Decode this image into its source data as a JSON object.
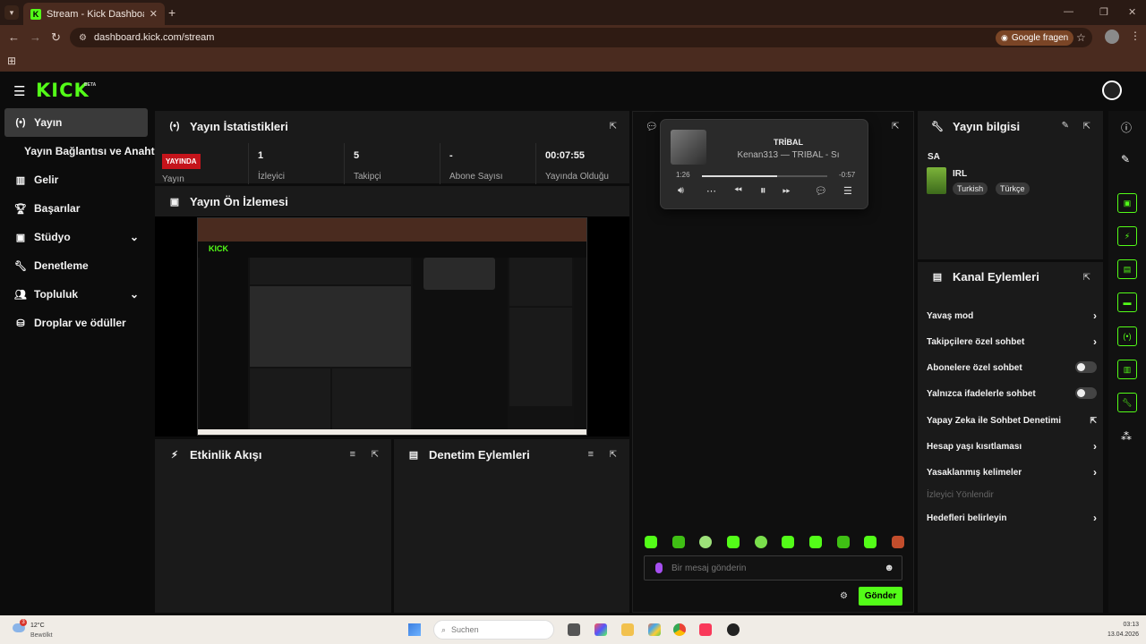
{
  "browser": {
    "tab_title": "Stream - Kick Dashboard",
    "tab_favicon": "K",
    "url": "dashboard.kick.com/stream",
    "translate_label": "Google fragen"
  },
  "header": {
    "logo": "KICK",
    "beta": "BETA"
  },
  "sidebar": {
    "items": [
      {
        "label": "Yayın",
        "icon": "broadcast-icon"
      },
      {
        "label": "Yayın Bağlantısı ve Anahtarı",
        "icon": ""
      },
      {
        "label": "Gelir",
        "icon": "chart-icon"
      },
      {
        "label": "Başarılar",
        "icon": "trophy-icon"
      },
      {
        "label": "Stüdyo",
        "icon": "studio-icon"
      },
      {
        "label": "Denetleme",
        "icon": "wrench-icon"
      },
      {
        "label": "Topluluk",
        "icon": "people-icon"
      },
      {
        "label": "Droplar ve ödüller",
        "icon": "gift-icon"
      }
    ]
  },
  "stats": {
    "title": "Yayın İstatistikleri",
    "live_badge": "YAYINDA",
    "live_label": "Yayın",
    "viewers_value": "1",
    "viewers_label": "İzleyici",
    "followers_value": "5",
    "followers_label": "Takipçi",
    "subs_value": "-",
    "subs_label": "Abone Sayısı",
    "uptime_value": "00:07:55",
    "uptime_label": "Yayında Olduğu"
  },
  "preview": {
    "title": "Yayın Ön İzlemesi"
  },
  "activity": {
    "title": "Etkinlik Akışı"
  },
  "modactions": {
    "title": "Denetim Eylemleri"
  },
  "music": {
    "song": "TRİBAL",
    "artist": "Kenan313 — TRİBAL - Sı",
    "elapsed": "1:26",
    "remaining": "-0:57",
    "progress": 0.6
  },
  "chat": {
    "placeholder": "Bir mesaj gönderin",
    "send_label": "Gönder"
  },
  "stream_info": {
    "title": "Yayın bilgisi",
    "stream_title": "SA",
    "category": "IRL",
    "tags": [
      "Turkish",
      "Türkçe"
    ]
  },
  "channel_actions": {
    "title": "Kanal Eylemleri",
    "slow_mode": "Yavaş mod",
    "followers_only": "Takipçilere özel sohbet",
    "subs_only": "Abonelere özel sohbet",
    "emotes_only": "Yalnızca ifadelerle sohbet",
    "ai_moderation": "Yapay Zeka ile Sohbet Denetimi",
    "account_age": "Hesap yaşı kısıtlaması",
    "banned_words": "Yasaklanmış kelimeler",
    "redirect_viewers": "İzleyici Yönlendir",
    "set_goals": "Hedefleri belirleyin"
  },
  "taskbar": {
    "weather_badge": "3",
    "weather_temp": "12°C",
    "weather_desc": "Bewölkt",
    "search_placeholder": "Suchen",
    "time": "03:13",
    "date": "13.04.2026"
  },
  "colors": {
    "accent": "#53fc18",
    "live": "#c5141b",
    "panel": "#1a1a1a",
    "bg": "#0c0c0c"
  }
}
